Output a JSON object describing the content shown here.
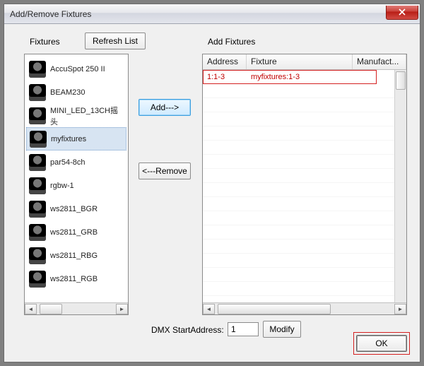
{
  "window": {
    "title": "Add/Remove Fixtures"
  },
  "labels": {
    "fixtures": "Fixtures",
    "refresh": "Refresh List",
    "add_fixtures": "Add Fixtures",
    "add_btn": "Add--->",
    "remove_btn": "<---Remove",
    "dmx": "DMX StartAddress:",
    "modify": "Modify",
    "ok": "OK"
  },
  "dmx_value": "1",
  "fixtures_list": [
    {
      "name": "AccuSpot 250 II",
      "selected": false
    },
    {
      "name": "BEAM230",
      "selected": false
    },
    {
      "name": "MINI_LED_13CH摇头",
      "selected": false
    },
    {
      "name": "myfixtures",
      "selected": true
    },
    {
      "name": "par54-8ch",
      "selected": false
    },
    {
      "name": "rgbw-1",
      "selected": false
    },
    {
      "name": "ws2811_BGR",
      "selected": false
    },
    {
      "name": "ws2811_GRB",
      "selected": false
    },
    {
      "name": "ws2811_RBG",
      "selected": false
    },
    {
      "name": "ws2811_RGB",
      "selected": false
    }
  ],
  "grid": {
    "columns": {
      "address": "Address",
      "fixture": "Fixture",
      "manufacturer": "Manufact..."
    },
    "rows": [
      {
        "address": "1:1-3",
        "fixture": "myfixtures:1-3",
        "manufacturer": "",
        "selected": true
      }
    ]
  }
}
